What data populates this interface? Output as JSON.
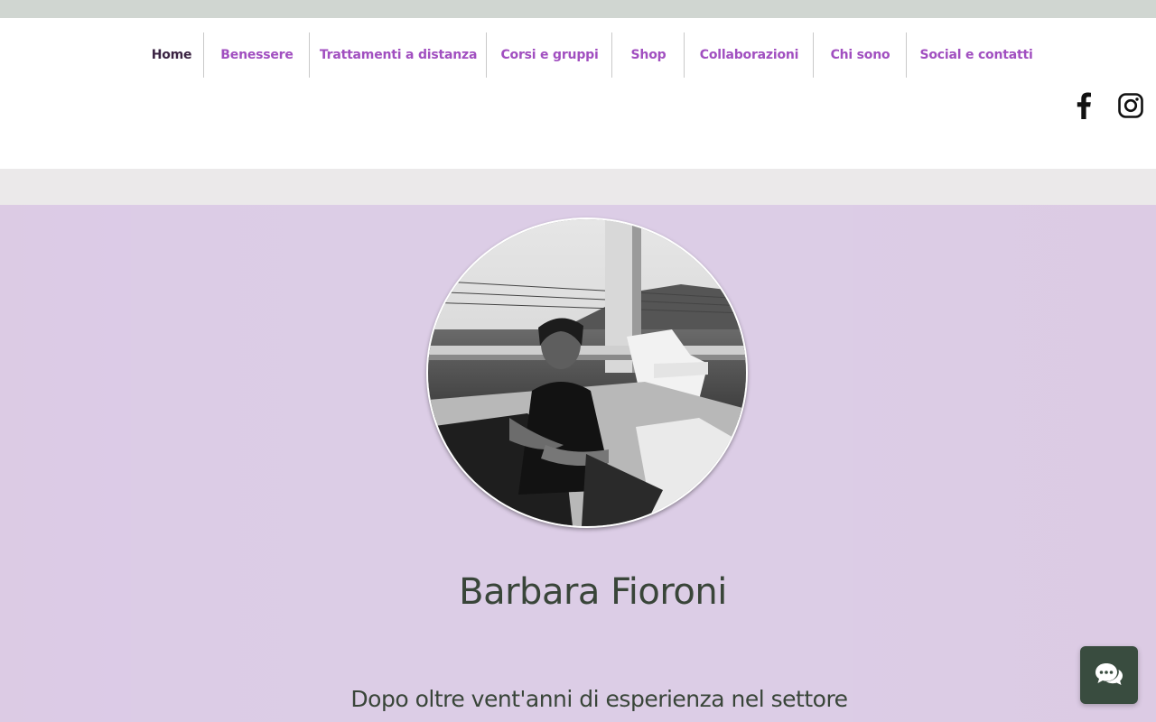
{
  "nav": {
    "items": [
      {
        "label": "Home",
        "active": true
      },
      {
        "label": "Benessere",
        "active": false
      },
      {
        "label": "Trattamenti a distanza",
        "active": false
      },
      {
        "label": "Corsi e gruppi",
        "active": false
      },
      {
        "label": "Shop",
        "active": false
      },
      {
        "label": "Collaborazioni",
        "active": false
      },
      {
        "label": "Chi sono",
        "active": false
      },
      {
        "label": "Social e contatti",
        "active": false
      }
    ]
  },
  "social": {
    "icons": [
      "facebook-icon",
      "instagram-icon"
    ]
  },
  "hero": {
    "name": "Barbara Fioroni",
    "intro": "Dopo oltre vent'anni di esperienza nel settore"
  },
  "chat": {
    "icon": "chat-bubbles-icon"
  },
  "colors": {
    "accent": "#a14fc0",
    "active_nav": "#3b2443",
    "hero_bg": "#dccde7",
    "heading": "#394539",
    "chat_bg": "#394c3f"
  }
}
